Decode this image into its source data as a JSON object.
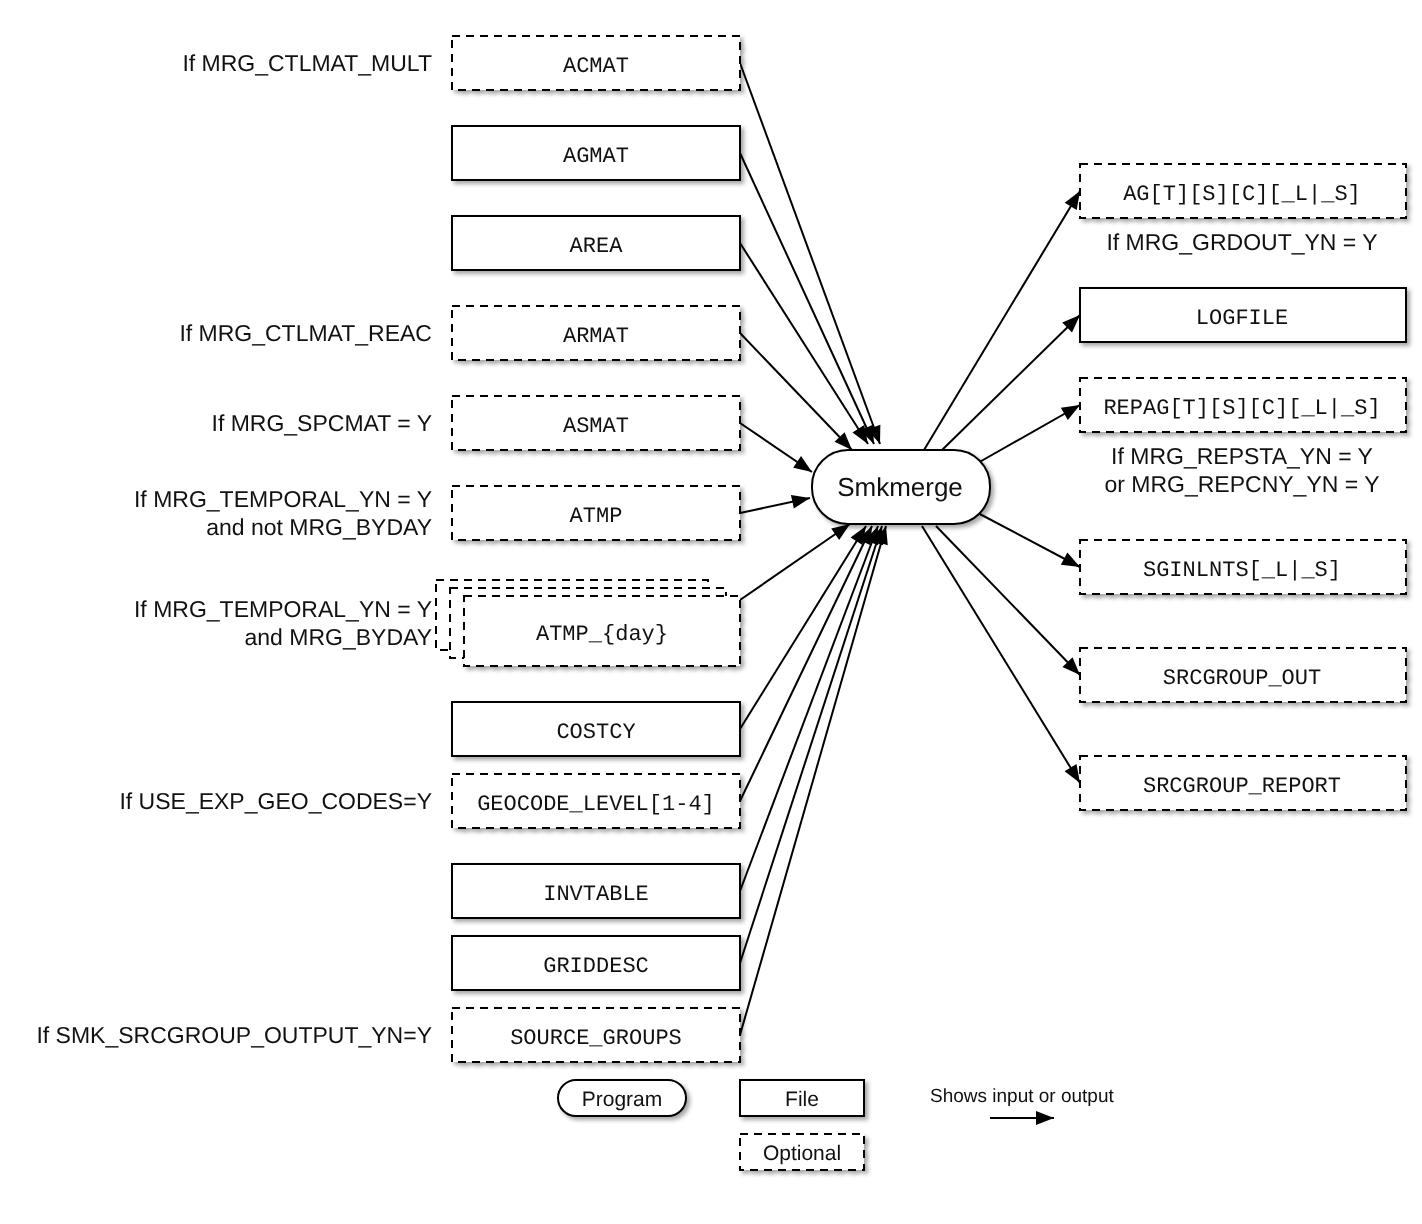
{
  "inputs": [
    {
      "name": "ACMAT",
      "optional": true,
      "multiple": false,
      "condition": [
        "If MRG_CTLMAT_MULT"
      ]
    },
    {
      "name": "AGMAT",
      "optional": false,
      "multiple": false
    },
    {
      "name": "AREA",
      "optional": false,
      "multiple": false
    },
    {
      "name": "ARMAT",
      "optional": true,
      "multiple": false,
      "condition": [
        "If MRG_CTLMAT_REAC"
      ]
    },
    {
      "name": "ASMAT",
      "optional": true,
      "multiple": false,
      "condition": [
        "If MRG_SPCMAT = Y"
      ]
    },
    {
      "name": "ATMP",
      "optional": true,
      "multiple": false,
      "condition": [
        "If MRG_TEMPORAL_YN = Y",
        "and not MRG_BYDAY"
      ]
    },
    {
      "name": "ATMP_{day}",
      "optional": true,
      "multiple": true,
      "condition": [
        "If MRG_TEMPORAL_YN = Y",
        "and MRG_BYDAY"
      ]
    },
    {
      "name": "COSTCY",
      "optional": false,
      "multiple": false
    },
    {
      "name": "GEOCODE_LEVEL[1-4]",
      "optional": true,
      "multiple": false,
      "condition": [
        "If USE_EXP_GEO_CODES=Y"
      ]
    },
    {
      "name": "INVTABLE",
      "optional": false,
      "multiple": false
    },
    {
      "name": "GRIDDESC",
      "optional": false,
      "multiple": false
    },
    {
      "name": "SOURCE_GROUPS",
      "optional": true,
      "multiple": false,
      "condition": [
        "If SMK_SRCGROUP_OUTPUT_YN=Y"
      ]
    }
  ],
  "program": "Smkmerge",
  "outputs": [
    {
      "name": "AG[T][S][C][_L|_S]",
      "optional": true,
      "condition": [
        "If MRG_GRDOUT_YN = Y"
      ]
    },
    {
      "name": "LOGFILE",
      "optional": false
    },
    {
      "name": "REPAG[T][S][C][_L|_S]",
      "optional": true,
      "condition": [
        "If MRG_REPSTA_YN = Y",
        "or MRG_REPCNY_YN = Y"
      ]
    },
    {
      "name": "SGINLNTS[_L|_S]",
      "optional": true
    },
    {
      "name": "SRCGROUP_OUT",
      "optional": true
    },
    {
      "name": "SRCGROUP_REPORT",
      "optional": true
    }
  ],
  "legend": {
    "program": "Program",
    "file": "File",
    "optional": "Optional",
    "arrow": "Shows input or output"
  }
}
